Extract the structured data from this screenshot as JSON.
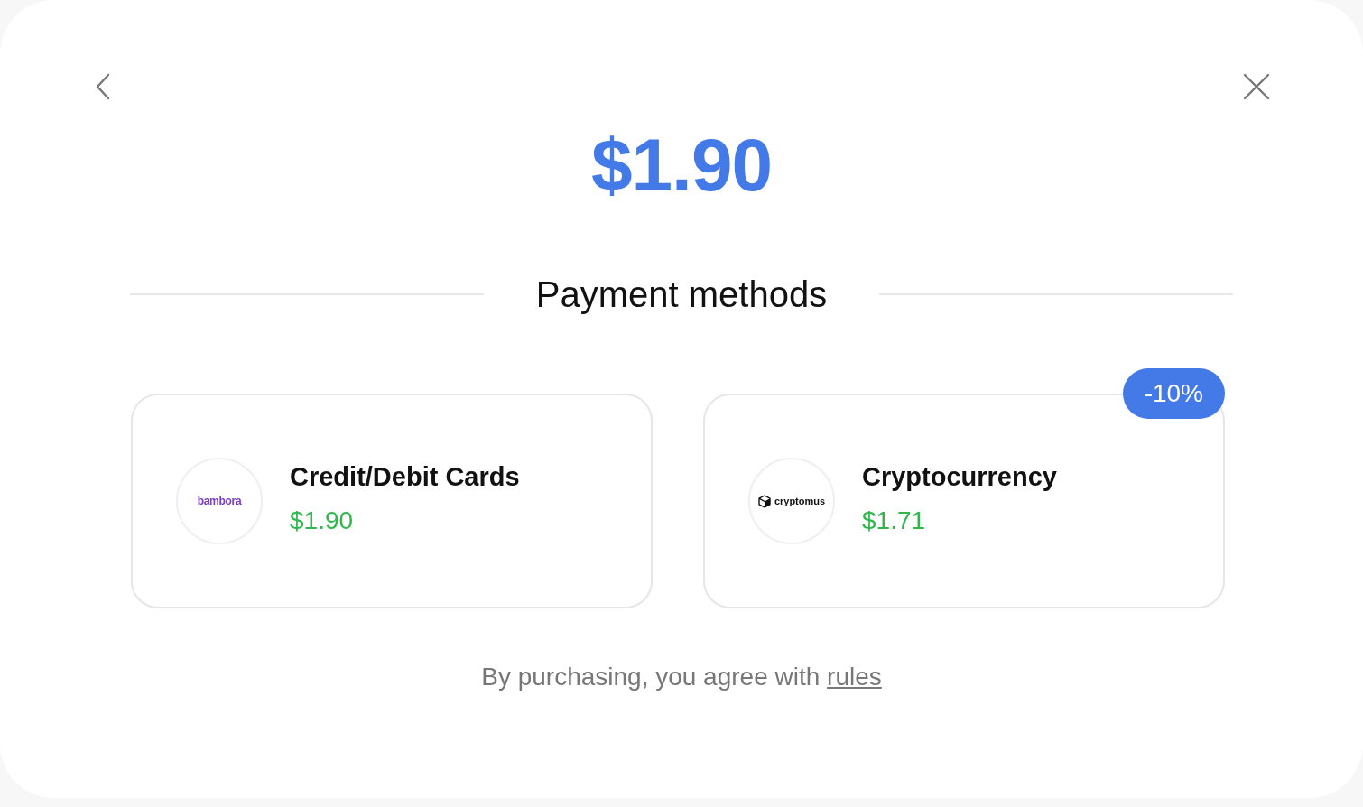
{
  "price": "$1.90",
  "section_title": "Payment methods",
  "methods": [
    {
      "kind": "bambora",
      "logo_text": "bambora",
      "name": "Credit/Debit Cards",
      "price": "$1.90"
    },
    {
      "kind": "cryptomus",
      "logo_text": "cryptomus",
      "name": "Cryptocurrency",
      "price": "$1.71",
      "badge": "-10%"
    }
  ],
  "footer": {
    "text": "By purchasing, you agree with",
    "link": "rules"
  }
}
